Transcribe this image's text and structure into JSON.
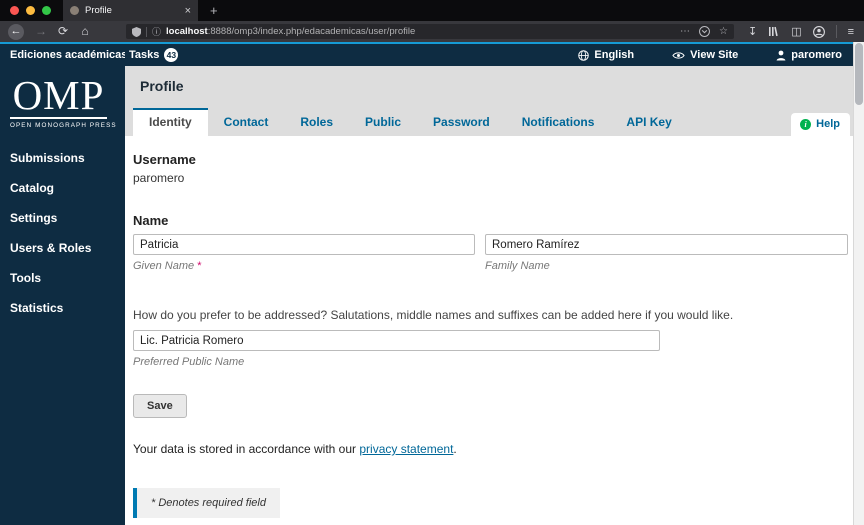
{
  "browser": {
    "tab_title": "Profile",
    "close_tab": "×",
    "new_tab": "+",
    "back": "←",
    "forward": "→",
    "reload": "⟳",
    "home": "⌂",
    "info": "ⓘ",
    "url_host": "localhost",
    "url_rest": ":8888/omp3/index.php/edacademicas/user/profile",
    "more": "⋯",
    "star": "☆",
    "download": "↧",
    "sidebar_toggle": "◫",
    "menu": "≡"
  },
  "topbar": {
    "press_name": "Ediciones académicas",
    "tasks_label": "Tasks",
    "tasks_count": "43",
    "language": "English",
    "view_site": "View Site",
    "username": "paromero"
  },
  "sidebar": {
    "logo_text": "OMP",
    "logo_subtext": "OPEN MONOGRAPH PRESS",
    "items": [
      "Submissions",
      "Catalog",
      "Settings",
      "Users & Roles",
      "Tools",
      "Statistics"
    ]
  },
  "page": {
    "title": "Profile",
    "tabs": [
      "Identity",
      "Contact",
      "Roles",
      "Public",
      "Password",
      "Notifications",
      "API Key"
    ],
    "help_label": "Help",
    "help_icon": "i"
  },
  "form": {
    "username_label": "Username",
    "username_value": "paromero",
    "name_label": "Name",
    "given_name_value": "Patricia",
    "given_name_label": "Given Name ",
    "required_star": "*",
    "family_name_value": "Romero Ramírez",
    "family_name_label": "Family Name",
    "preferred_hint": "How do you prefer to be addressed? Salutations, middle names and suffixes can be added here if you would like.",
    "preferred_value": "Lic. Patricia Romero",
    "preferred_label": "Preferred Public Name",
    "save_label": "Save",
    "privacy_prefix": "Your data is stored in accordance with our ",
    "privacy_link": "privacy statement",
    "privacy_suffix": ".",
    "required_note": "* Denotes required field"
  }
}
